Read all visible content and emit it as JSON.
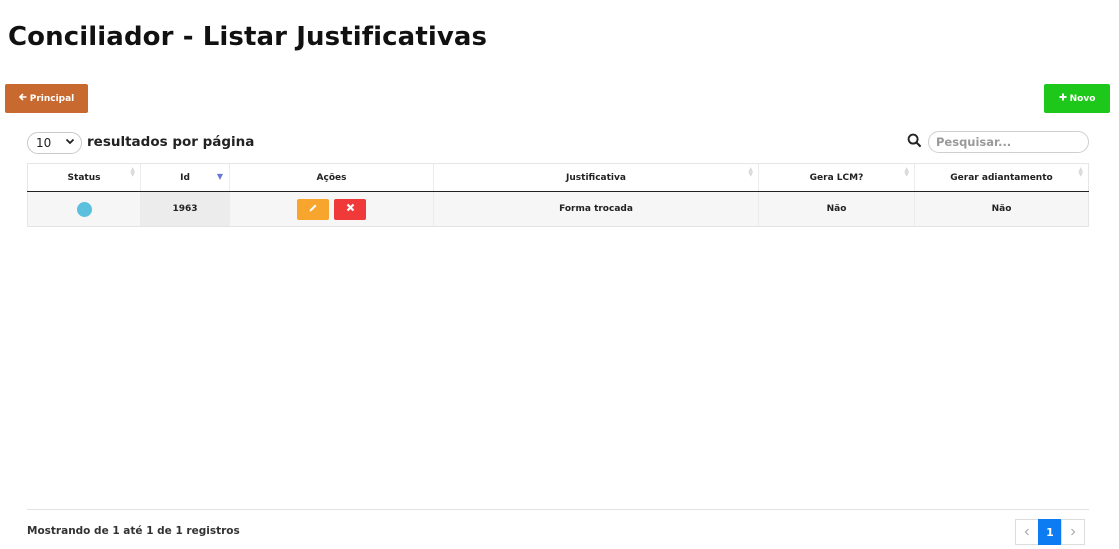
{
  "page": {
    "title": "Conciliador - Listar Justificativas"
  },
  "toolbar": {
    "principal_label": "Principal",
    "novo_label": "Novo"
  },
  "length": {
    "value": "10",
    "label": "resultados por página"
  },
  "search": {
    "placeholder": "Pesquisar..."
  },
  "table": {
    "columns": [
      "Status",
      "Id",
      "Ações",
      "Justificativa",
      "Gera LCM?",
      "Gerar adiantamento"
    ],
    "rows": [
      {
        "status_color": "#5bc0de",
        "id": "1963",
        "justificativa": "Forma trocada",
        "gera_lcm": "Não",
        "gerar_adiantamento": "Não"
      }
    ]
  },
  "footer": {
    "info": "Mostrando de 1 até 1 de 1 registros",
    "pages": [
      "1"
    ],
    "current_page": "1"
  },
  "colors": {
    "principal": "#c8692f",
    "novo": "#1ec81a",
    "edit": "#f8a52e",
    "delete": "#f03a3a",
    "page_active": "#0d7cf2"
  },
  "icons": {
    "principal": "arrow-left-icon",
    "novo": "plus-icon",
    "search": "search-icon",
    "edit": "pencil-icon",
    "delete": "close-icon"
  }
}
